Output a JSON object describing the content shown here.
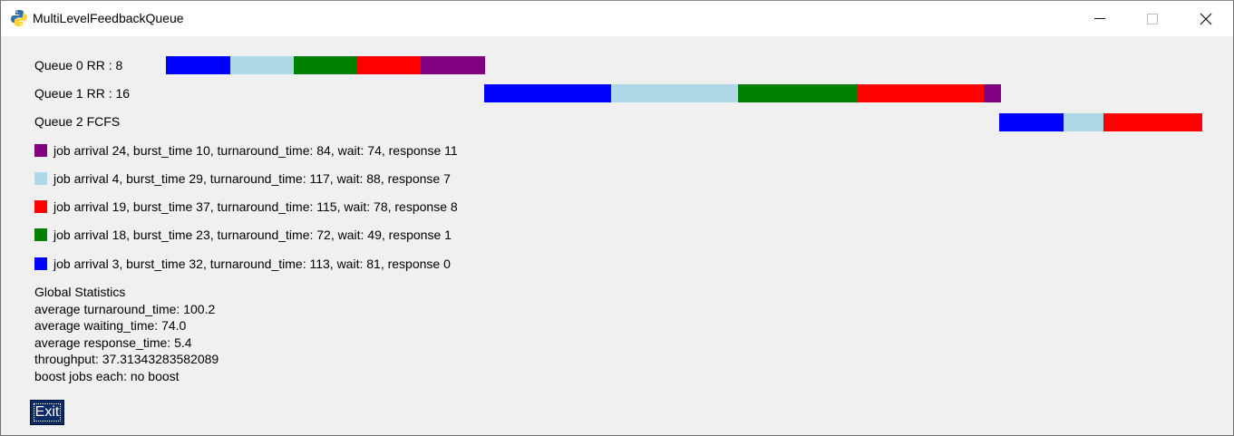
{
  "window": {
    "title": "MultiLevelFeedbackQueue"
  },
  "colors": {
    "blue": "#0000ff",
    "lightblue": "#add8e6",
    "green": "#008000",
    "red": "#ff0000",
    "purple": "#800080"
  },
  "queues": [
    {
      "label": "Queue 0 RR : 8"
    },
    {
      "label": "Queue 1 RR : 16"
    },
    {
      "label": "Queue 2 FCFS"
    }
  ],
  "legend": [
    {
      "color": "#800080",
      "text": "job arrival 24, burst_time 10, turnaround_time: 84, wait: 74, response 11"
    },
    {
      "color": "#add8e6",
      "text": "job arrival 4, burst_time 29, turnaround_time: 117, wait: 88, response 7"
    },
    {
      "color": "#ff0000",
      "text": "job arrival 19, burst_time 37, turnaround_time: 115, wait: 78, response 8"
    },
    {
      "color": "#008000",
      "text": "job arrival 18, burst_time 23, turnaround_time: 72, wait: 49, response 1"
    },
    {
      "color": "#0000ff",
      "text": "job arrival 3, burst_time 32, turnaround_time: 113, wait: 81, response 0"
    }
  ],
  "stats": {
    "heading": "Global Statistics",
    "avg_turnaround": "average turnaround_time: 100.2",
    "avg_waiting": "average waiting_time: 74.0",
    "avg_response": "average response_time: 5.4",
    "throughput": "throughput: 37.31343283582089",
    "boost": "boost jobs each: no boost"
  },
  "buttons": {
    "exit_label": "Exit"
  }
}
